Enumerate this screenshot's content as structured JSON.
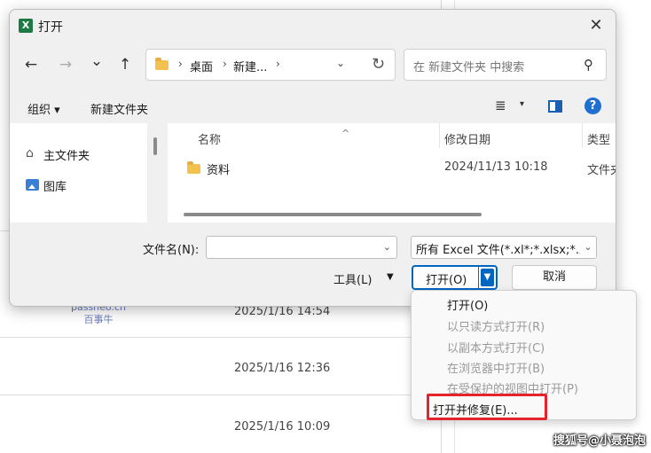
{
  "background": {
    "dates": [
      "2025/1/16 14:54",
      "2025/1/16 12:36",
      "2025/1/16 10:09"
    ],
    "watermark_site": "passneo.cn",
    "watermark_name": "百事牛",
    "corner_watermark": "搜狐号@小聂泡泡"
  },
  "dialog": {
    "title": "打开",
    "nav": {
      "back_icon": "←",
      "forward_icon": "→",
      "recent_icon": "⌄",
      "up_icon": "↑",
      "breadcrumbs": [
        "桌面",
        "新建..."
      ],
      "dropdown_icon": "⌄",
      "refresh_icon": "↻",
      "search_placeholder": "在 新建文件夹 中搜索",
      "search_icon": "⚲"
    },
    "commands": {
      "organize": "组织 ▾",
      "new_folder": "新建文件夹",
      "view_icon": "≣",
      "help_icon": "?"
    },
    "navpane": {
      "items": [
        "主文件夹",
        "图库"
      ]
    },
    "columns": [
      "名称",
      "修改日期",
      "类型"
    ],
    "files": [
      {
        "name": "资料",
        "date": "2024/11/13 10:18",
        "type": "文件夹"
      }
    ],
    "filename_label": "文件名(N):",
    "filename_value": "",
    "filetype_value": "所有 Excel 文件(*.xl*;*.xlsx;*.xlsm",
    "tools_label": "工具(L)",
    "open_label": "打开(O)",
    "cancel_label": "取消"
  },
  "open_menu": {
    "items": [
      {
        "label": "打开(O)",
        "enabled": true
      },
      {
        "label": "以只读方式打开(R)",
        "enabled": false
      },
      {
        "label": "以副本方式打开(C)",
        "enabled": false
      },
      {
        "label": "在浏览器中打开(B)",
        "enabled": false
      },
      {
        "label": "在受保护的视图中打开(P)",
        "enabled": false
      },
      {
        "label": "打开并修复(E)...",
        "enabled": true
      }
    ],
    "highlight_color": "#e3242b"
  }
}
